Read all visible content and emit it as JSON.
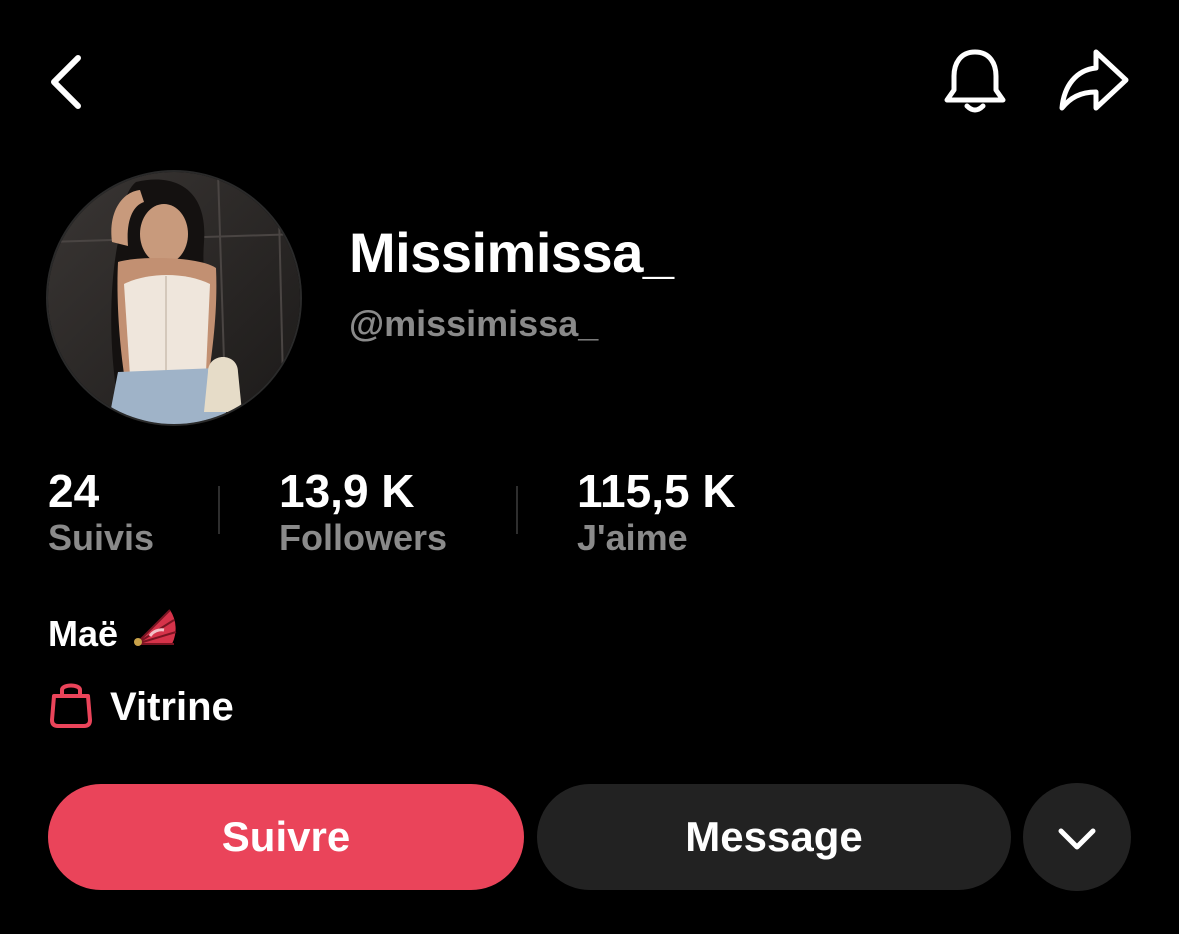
{
  "profile": {
    "display_name": "Missimissa_",
    "handle": "@missimissa_",
    "bio_name": "Maë",
    "bio_emoji": "🪭",
    "storefront_label": "Vitrine"
  },
  "stats": {
    "following": {
      "value": "24",
      "label": "Suivis"
    },
    "followers": {
      "value": "13,9 K",
      "label": "Followers"
    },
    "likes": {
      "value": "115,5 K",
      "label": "J'aime"
    }
  },
  "actions": {
    "follow_label": "Suivre",
    "message_label": "Message"
  },
  "icons": {
    "back": "chevron-left-icon",
    "notifications": "bell-icon",
    "share": "share-arrow-icon",
    "storefront": "shopping-bag-icon",
    "more": "chevron-down-icon"
  },
  "colors": {
    "background": "#000000",
    "accent": "#ea445a",
    "secondary_button": "#222222",
    "muted_text": "#8a8a8a"
  }
}
